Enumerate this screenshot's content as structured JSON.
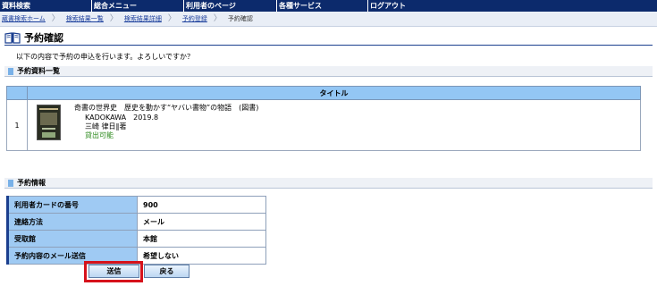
{
  "nav": {
    "items": [
      {
        "label": "資料検索"
      },
      {
        "label": "総合メニュー"
      },
      {
        "label": "利用者のページ"
      },
      {
        "label": "各種サービス"
      },
      {
        "label": "ログアウト"
      }
    ]
  },
  "breadcrumb": {
    "items": [
      "蔵書検索ホーム",
      "検索結果一覧",
      "検索結果詳細",
      "予約登録"
    ],
    "current": "予約確認"
  },
  "page": {
    "title": "予約確認",
    "message": "以下の内容で予約の申込を行います。よろしいですか？"
  },
  "list_section": {
    "heading": "予約資料一覧",
    "column_title": "タイトル",
    "items": [
      {
        "number": "1",
        "title": "奇書の世界史　歴史を動かす“ヤバい書物”の物語　(図書)",
        "publisher_year": "KADOKAWA　2019.8",
        "author": "三崎 律日‖著",
        "status": "貸出可能",
        "status_color": "#2c8a1c"
      }
    ]
  },
  "info_section": {
    "heading": "予約情報",
    "rows": [
      {
        "label": "利用者カードの番号",
        "value": "900"
      },
      {
        "label": "連絡方法",
        "value": "メール"
      },
      {
        "label": "受取館",
        "value": "本館"
      },
      {
        "label": "予約内容のメール送信",
        "value": "希望しない"
      }
    ]
  },
  "buttons": {
    "send": "送信",
    "back": "戻る"
  },
  "colors": {
    "nav_bg": "#0c2a6c",
    "header_blue": "#93c6f4",
    "highlight_red": "#d6121b"
  }
}
